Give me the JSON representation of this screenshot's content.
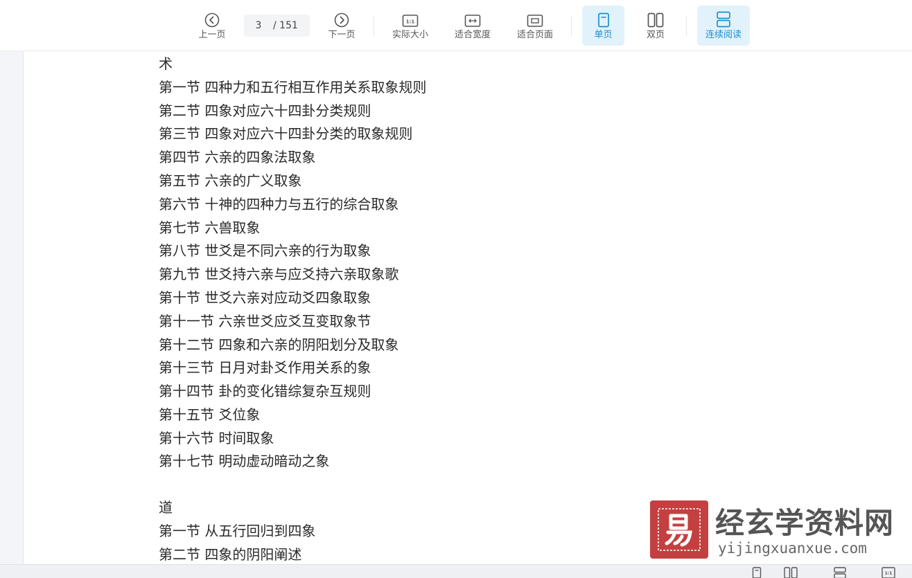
{
  "toolbar": {
    "prev_label": "上一页",
    "next_label": "下一页",
    "current_page": "3",
    "total_pages": "/ 151",
    "actual_size_label": "实际大小",
    "fit_width_label": "适合宽度",
    "fit_page_label": "适合页面",
    "single_page_label": "单页",
    "double_page_label": "双页",
    "continuous_label": "连续阅读",
    "icons": [
      "prev-page-icon",
      "next-page-icon",
      "actual-size-icon",
      "fit-width-icon",
      "fit-page-icon",
      "single-page-icon",
      "double-page-icon",
      "continuous-read-icon"
    ],
    "accent_color": "#1a8fd0",
    "active_bg": "#e2f2fb"
  },
  "document": {
    "lines": [
      "术",
      "第一节 四种力和五行相互作用关系取象规则",
      "第二节 四象对应六十四卦分类规则",
      "第三节 四象对应六十四卦分类的取象规则",
      "第四节 六亲的四象法取象",
      "第五节 六亲的广义取象",
      "第六节 十神的四种力与五行的综合取象",
      "第七节 六兽取象",
      "第八节 世爻是不同六亲的行为取象",
      "第九节 世爻持六亲与应爻持六亲取象歌",
      "第十节 世爻六亲对应动爻四象取象",
      "第十一节 六亲世爻应爻互变取象节",
      "第十二节 四象和六亲的阴阳划分及取象",
      "第十三节 日月对卦爻作用关系的象",
      "第十四节 卦的变化错综复杂互规则",
      "第十五节 爻位象",
      "第十六节 时间取象",
      "第十七节 明动虚动暗动之象",
      "道",
      "第一节 从五行回归到四象",
      "第二节 四象的阴阳阐述"
    ]
  },
  "watermark": {
    "logo_char": "易",
    "title": "经玄学资料网",
    "url": "yijingxuanxue.com",
    "logo_color": "#c44040"
  },
  "statusbar": {
    "icons": [
      "single-page-icon",
      "double-page-icon",
      "continuous-read-icon",
      "actual-size-icon"
    ],
    "actual_size_text": "1:1"
  }
}
